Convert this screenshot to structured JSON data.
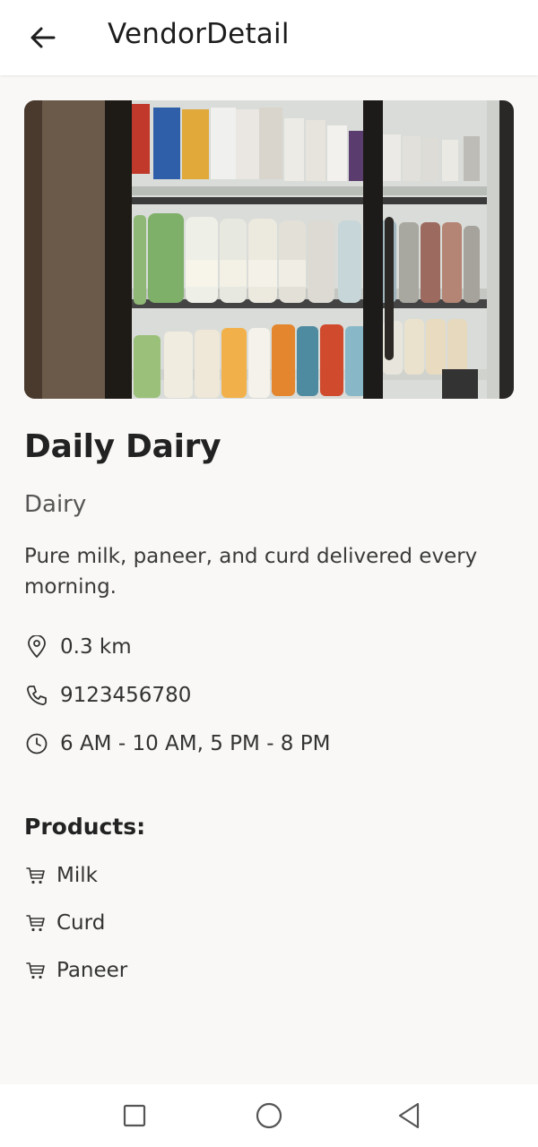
{
  "header": {
    "title": "VendorDetail",
    "back_icon": "arrow-left-icon"
  },
  "vendor": {
    "image_description_icon": "vendor-photo",
    "name": "Daily Dairy",
    "category": "Dairy",
    "description": "Pure milk, paneer, and curd delivered every morning.",
    "distance": "0.3 km",
    "phone": "9123456780",
    "hours": "6 AM - 10 AM, 5 PM - 8 PM"
  },
  "products": {
    "title": "Products:",
    "items": [
      {
        "label": "Milk",
        "icon": "cart-icon"
      },
      {
        "label": "Curd",
        "icon": "cart-icon"
      },
      {
        "label": "Paneer",
        "icon": "cart-icon"
      }
    ]
  },
  "navbar": {
    "recents_icon": "square-icon",
    "home_icon": "circle-icon",
    "back_icon": "triangle-back-icon"
  },
  "colors": {
    "background": "#f9f8f6",
    "appbar": "#ffffff",
    "text_primary": "#222222",
    "text_secondary": "#555555"
  }
}
